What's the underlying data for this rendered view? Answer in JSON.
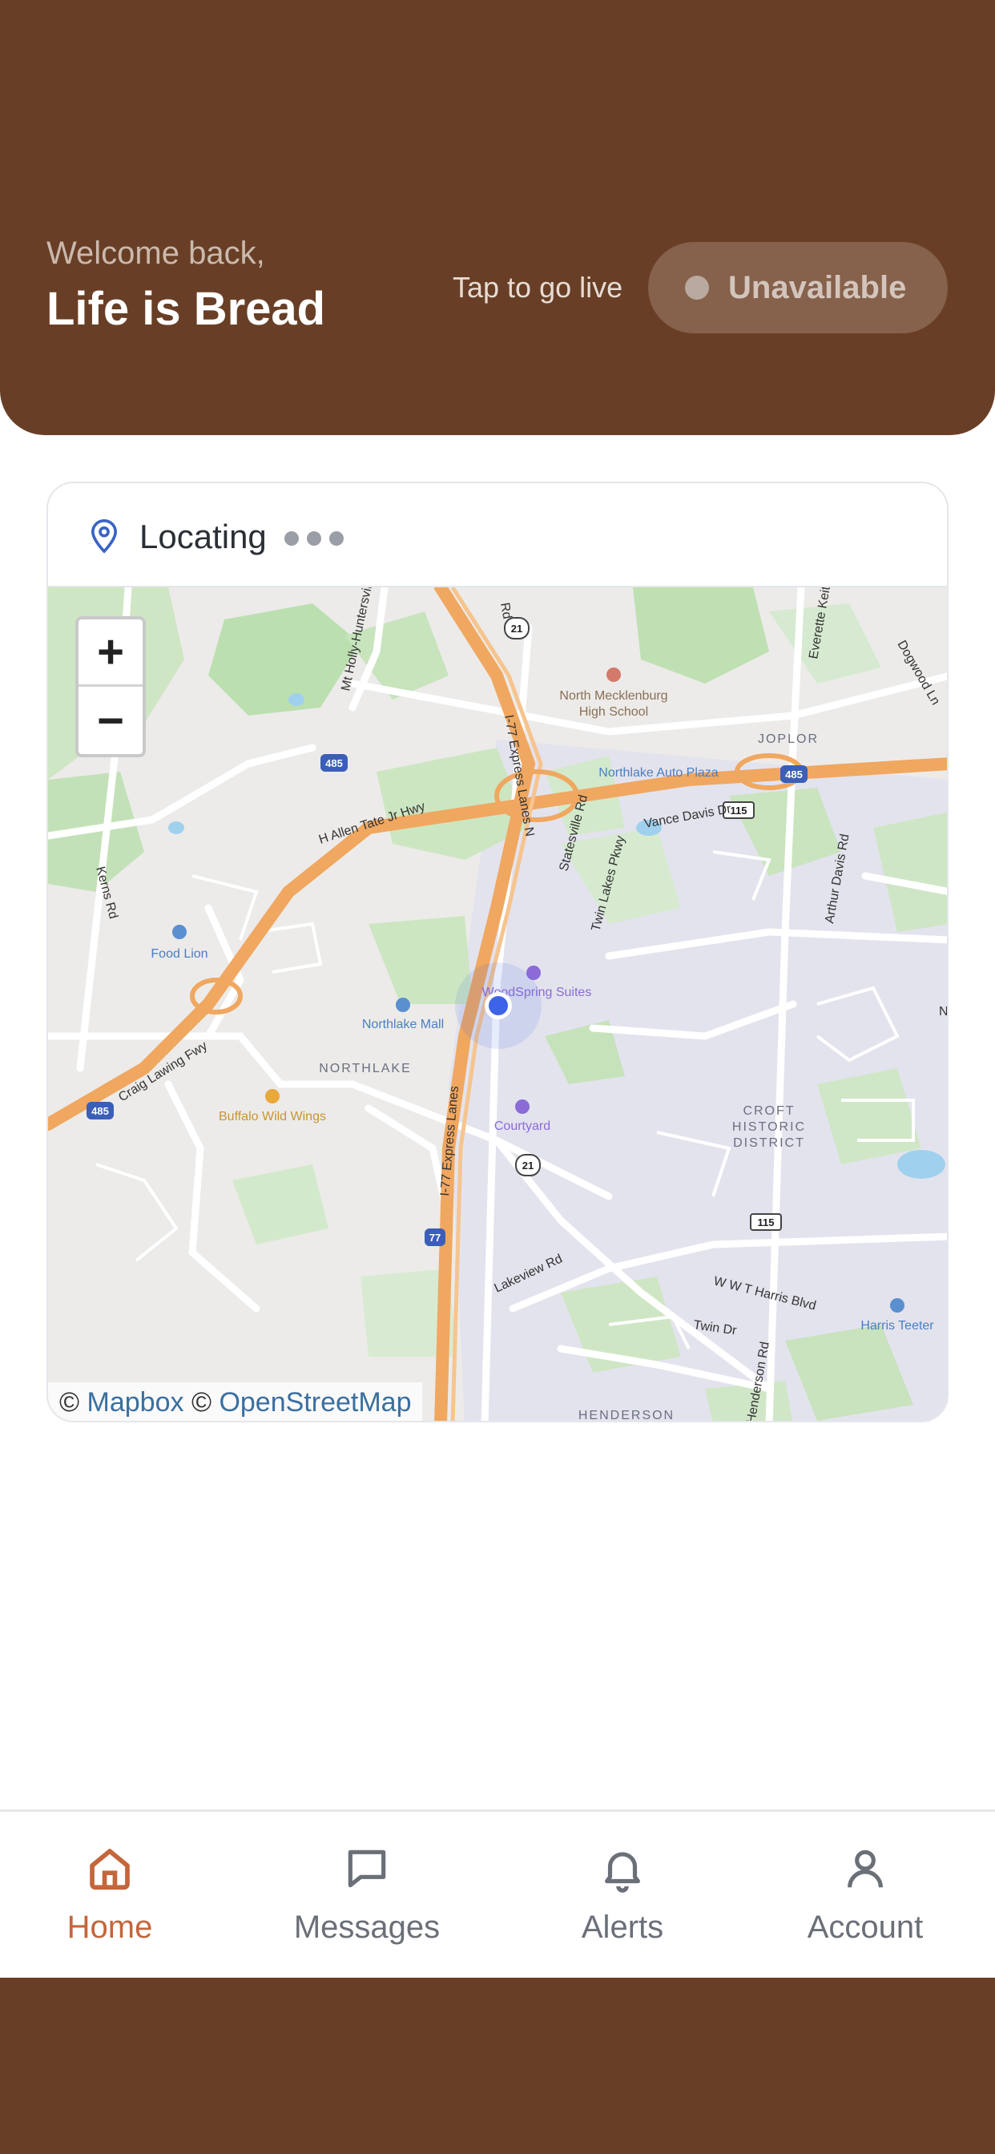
{
  "header": {
    "welcome": "Welcome back,",
    "name": "Life is Bread",
    "tap_live": "Tap to go live",
    "status": "Unavailable"
  },
  "location_card": {
    "title": "Locating",
    "zoom_in": "+",
    "zoom_out": "−",
    "attribution_prefix1": "©",
    "attribution_link1": "Mapbox",
    "attribution_prefix2": "©",
    "attribution_link2": "OpenStreetMap"
  },
  "map_labels": {
    "north_meck_1": "North Mecklenburg",
    "north_meck_2": "High School",
    "northlake_auto": "Northlake Auto Plaza",
    "joplor": "JOPLOR",
    "allen_tate": "H Allen Tate Jr Hwy",
    "vance_davis": "Vance Davis Dr",
    "statesville": "Statesville Rd",
    "twin_lakes": "Twin Lakes Pkwy",
    "express_lanes_n": "I-77 Express Lanes N",
    "express_lanes_s": "I-77 Express Lanes",
    "food_lion": "Food Lion",
    "northlake_mall": "Northlake Mall",
    "northlake": "NORTHLAKE",
    "woodspring": "WoodSpring Suites",
    "courtyard": "Courtyard",
    "craig_lawing": "Craig Lawing Fwy",
    "buffalo": "Buffalo Wild Wings",
    "croft1": "CROFT",
    "croft2": "HISTORIC",
    "croft3": "DISTRICT",
    "lakeview": "Lakeview Rd",
    "wwt_harris": "W W T Harris Blvd",
    "twin_dr": "Twin Dr",
    "harris_teeter": "Harris Teeter",
    "henderson": "HENDERSON",
    "henderson_rd": "Henderson Rd",
    "mt_holly": "Mt Holly-Huntersville",
    "everette": "Everette Keith",
    "dogwood": "Dogwood Ln",
    "arthur_davis": "Arthur Davis Rd",
    "kerns": "Kerns Rd",
    "shield_485": "485",
    "shield_21": "21",
    "shield_115": "115",
    "shield_77": "77",
    "edge_n": "N",
    "rd_fragment": "Rd"
  },
  "tabs": [
    {
      "label": "Home",
      "icon": "home-icon",
      "active": true
    },
    {
      "label": "Messages",
      "icon": "message-icon",
      "active": false
    },
    {
      "label": "Alerts",
      "icon": "bell-icon",
      "active": false
    },
    {
      "label": "Account",
      "icon": "user-icon",
      "active": false
    }
  ],
  "colors": {
    "brand_brown": "#683f26",
    "active_tab": "#c4663b",
    "location_dot": "#3d63e6"
  }
}
